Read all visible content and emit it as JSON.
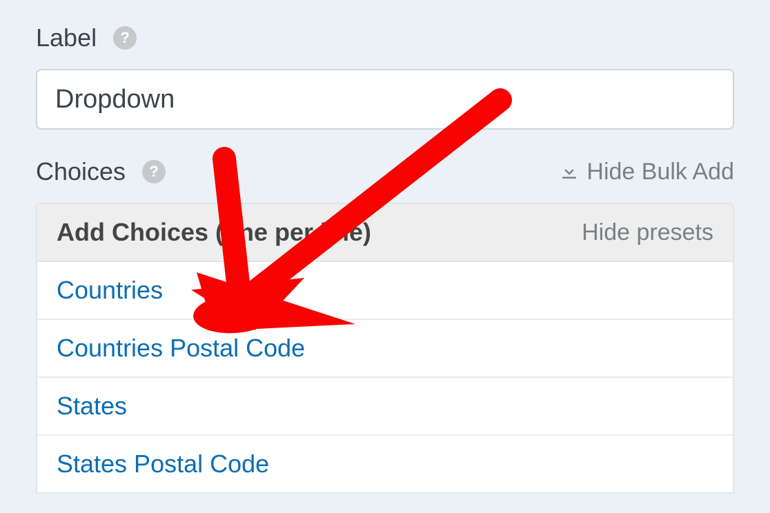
{
  "label_section": {
    "title": "Label",
    "input_value": "Dropdown"
  },
  "choices_section": {
    "title": "Choices",
    "hide_bulk_label": "Hide Bulk Add",
    "panel_title": "Add Choices (one per line)",
    "hide_presets_label": "Hide presets",
    "presets": [
      "Countries",
      "Countries Postal Code",
      "States",
      "States Postal Code"
    ]
  }
}
